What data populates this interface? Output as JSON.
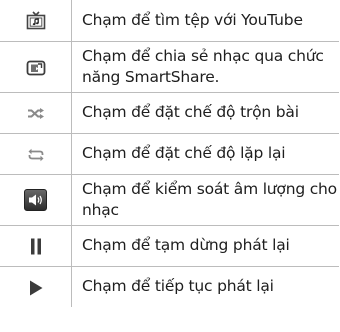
{
  "rows": [
    {
      "icon": "youtube-music-icon",
      "text": "Chạm để tìm tệp với YouTube"
    },
    {
      "icon": "smartshare-icon",
      "text": "Chạm để chia sẻ nhạc qua chức năng SmartShare."
    },
    {
      "icon": "shuffle-icon",
      "text": "Chạm để đặt chế độ trộn bài"
    },
    {
      "icon": "repeat-icon",
      "text": "Chạm để đặt chế độ lặp lại"
    },
    {
      "icon": "volume-icon",
      "text": "Chạm để kiểm soát âm lượng cho nhạc"
    },
    {
      "icon": "pause-icon",
      "text": "Chạm để tạm dừng phát lại"
    },
    {
      "icon": "play-icon",
      "text": "Chạm để tiếp tục phát lại"
    }
  ],
  "colors": {
    "text": "#1e1e1e",
    "divider": "#bcbcbc",
    "icon_dark": "#3c3c3c",
    "icon_light": "#8a8a8a"
  }
}
